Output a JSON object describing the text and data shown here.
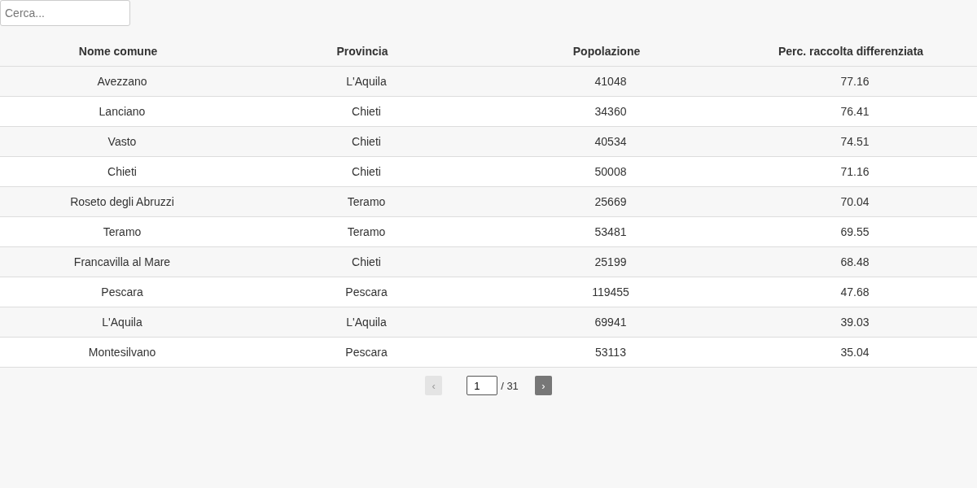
{
  "search": {
    "placeholder": "Cerca..."
  },
  "table": {
    "columns": [
      "Nome comune",
      "Provincia",
      "Popolazione",
      "Perc. raccolta differenziata"
    ],
    "rows": [
      [
        "Avezzano",
        "L'Aquila",
        "41048",
        "77.16"
      ],
      [
        "Lanciano",
        "Chieti",
        "34360",
        "76.41"
      ],
      [
        "Vasto",
        "Chieti",
        "40534",
        "74.51"
      ],
      [
        "Chieti",
        "Chieti",
        "50008",
        "71.16"
      ],
      [
        "Roseto degli Abruzzi",
        "Teramo",
        "25669",
        "70.04"
      ],
      [
        "Teramo",
        "Teramo",
        "53481",
        "69.55"
      ],
      [
        "Francavilla al Mare",
        "Chieti",
        "25199",
        "68.48"
      ],
      [
        "Pescara",
        "Pescara",
        "119455",
        "47.68"
      ],
      [
        "L'Aquila",
        "L'Aquila",
        "69941",
        "39.03"
      ],
      [
        "Montesilvano",
        "Pescara",
        "53113",
        "35.04"
      ]
    ]
  },
  "pagination": {
    "previous": {
      "label": "‹",
      "disabled": true
    },
    "page": "1",
    "total": "/ 31",
    "next": {
      "label": "›",
      "disabled": false
    }
  }
}
